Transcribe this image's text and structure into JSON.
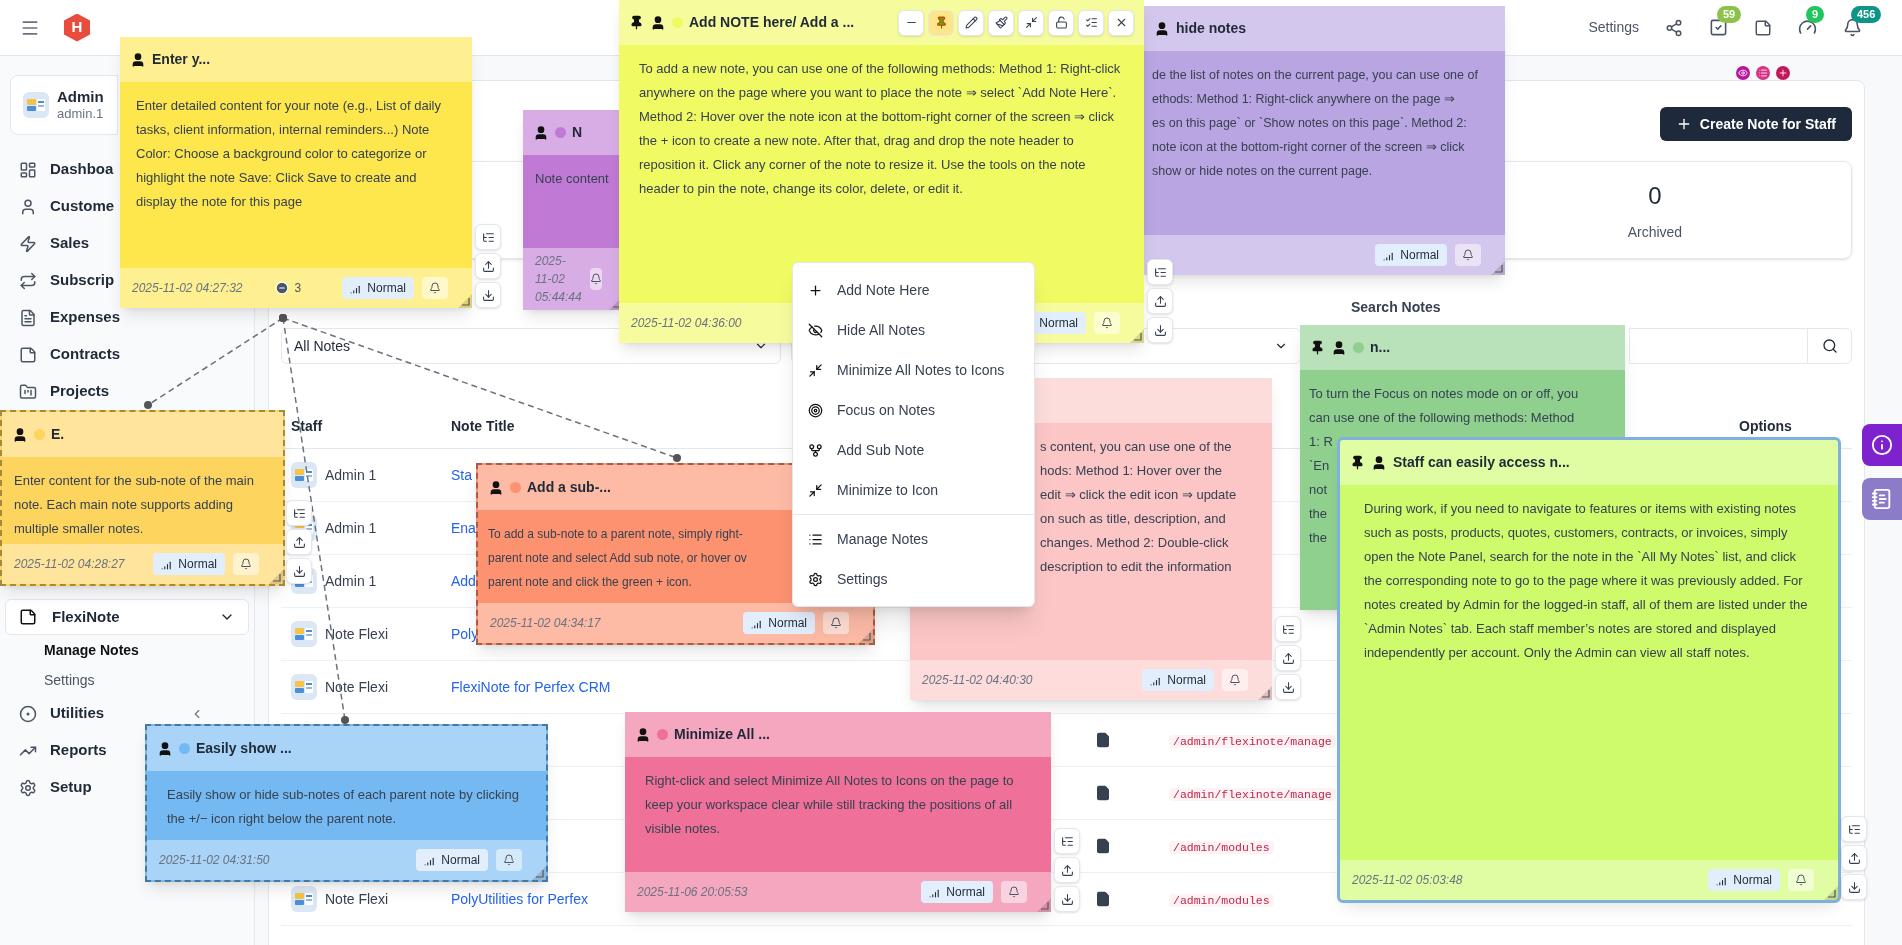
{
  "header": {
    "logo": "H",
    "settings_label": "Settings",
    "badges": [
      {
        "count": "59",
        "color": "#8bc34a"
      },
      {
        "count": "9",
        "color": "#22c55e"
      },
      {
        "count": "456",
        "color": "#0f9488"
      }
    ]
  },
  "sidebar": {
    "profile": {
      "name": "Admin",
      "email": "admin.1"
    },
    "items": [
      {
        "label": "Dashboa"
      },
      {
        "label": "Custome"
      },
      {
        "label": "Sales"
      },
      {
        "label": "Subscrip"
      },
      {
        "label": "Expenses"
      },
      {
        "label": "Contracts"
      },
      {
        "label": "Projects"
      }
    ],
    "group": {
      "label": "FlexiNote",
      "expanded": true,
      "children": [
        {
          "label": "Manage Notes",
          "selected": true
        },
        {
          "label": "Settings",
          "selected": false
        }
      ]
    },
    "items_after": [
      {
        "label": "Utilities"
      },
      {
        "label": "Reports"
      },
      {
        "label": "Setup"
      }
    ]
  },
  "main": {
    "create_button": "Create Note for Staff",
    "stats": [
      {
        "value": "0",
        "label": "Archived"
      }
    ],
    "staff_filter": {
      "value": "All Notes"
    },
    "search_label": "Search Notes",
    "table": {
      "columns": [
        "Staff",
        "Note Title",
        "Options"
      ],
      "rows": [
        {
          "staff": "Admin 1",
          "title": "Sta"
        },
        {
          "staff": "Admin 1",
          "title": "Ena"
        },
        {
          "staff": "Admin 1",
          "title": "Add"
        },
        {
          "staff": "Note Flexi",
          "title": "Poly"
        },
        {
          "staff": "Note Flexi",
          "title": "FlexiNote for Perfex CRM"
        },
        {
          "url": "/admin/flexinote/manage"
        },
        {
          "url": "/admin/flexinote/manage"
        },
        {
          "url": "/admin/modules"
        },
        {
          "staff": "Note Flexi",
          "title": "PolyUtilities for Perfex",
          "url": "/admin/modules"
        }
      ]
    }
  },
  "notes": [
    {
      "title": "Enter y...",
      "color": "#fde74c",
      "side_tools": true,
      "body": "Enter detailed content for your note (e.g., List of daily tasks, client information, internal reminders...) Note Color: Choose a background color to categorize or highlight the note Save: Click Save to create and display the note for this page",
      "timestamp": "2025-11-02 04:27:32",
      "count": "3",
      "priority": "Normal"
    },
    {
      "title": "N",
      "color": "#c07ad6",
      "dot": true,
      "body": "Note content",
      "timestamp": "2025-11-02 05:44:44"
    },
    {
      "title": "Add NOTE here/ Add a ...",
      "color": "#f0fa63",
      "pinned": true,
      "dot": true,
      "side_tools": true,
      "toolbar": {
        "pin_active": true
      },
      "body": "To add a new note, you can use one of the following methods: Method 1: Right-click anywhere on the page where you want to place the note ⇒ select `Add Note Here`. Method 2: Hover over the note icon at the bottom-right corner of the screen ⇒ click the + icon to create a new note. After that, drag and drop the note header to reposition it. Click any corner of the note to resize it. Use the tools on the note header to pin the note, change its color, delete, or edit it.",
      "timestamp": "2025-11-02 04:36:00",
      "priority": "Normal"
    },
    {
      "title": "hide notes",
      "color": "#b9a5e2",
      "body": "de the list of notes on the current page, you can use one of\nethods: Method 1: Right-click anywhere on the page ⇒\nes on this page` or `Show notes on this page`. Method 2:\nnote icon at the bottom-right corner of the screen ⇒ click\nshow or hide notes on the current page.",
      "priority": "Normal"
    },
    {
      "color": "#fcc6c6",
      "side_tools": true,
      "body": "s content, you can use one of the\nhods: Method 1: Hover over the\nedit ⇒ click the edit icon ⇒ update\non such as title, description, and\nchanges. Method 2: Double-click\ndescription to edit the information",
      "timestamp": "2025-11-02 04:40:30",
      "priority": "Normal"
    },
    {
      "title": "n...",
      "color": "#8fd08f",
      "pinned": true,
      "dot": true,
      "body": "To turn the Focus on notes mode on or off, you\ncan use one of the following methods: Method\n1: R\n`En\nnot\nthe\nthe"
    },
    {
      "title": "Staff can easily access n...",
      "color": "#cdfb6c",
      "pinned": true,
      "outlined": true,
      "side_tools": true,
      "body": "During work, if you need to navigate to features or items with existing notes such as posts, products, quotes, customers, contracts, or invoices, simply open the Note Panel, search for the note in the `All My Notes` list, and click the corresponding note to go to the page where it was previously added. For notes created by Admin for the logged-in staff, all of them are listed under the `Admin Notes` tab. Each staff member’s notes are stored and displayed independently per account. Only the Admin can view all staff notes.",
      "timestamp": "2025-11-02 05:03:48",
      "priority": "Normal"
    },
    {
      "title": "E.",
      "color": "#fdd55e",
      "dot": true,
      "dashed": true,
      "side_tools": true,
      "body": "Enter content for the sub-note of the main note. Each main note supports adding multiple smaller notes.",
      "timestamp": "2025-11-02 04:28:27",
      "priority": "Normal"
    },
    {
      "title": "Add a sub-...",
      "color": "#fc9270",
      "dot": true,
      "dashed": true,
      "body": "To add a sub-note to a parent note, simply right-\nparent note and select Add sub note, or hover ov\nparent note and click the green + icon.",
      "timestamp": "2025-11-02 04:34:17",
      "priority": "Normal"
    },
    {
      "title": "Easily show ...",
      "color": "#74b9f2",
      "dot": true,
      "dashed": true,
      "body": "Easily show or hide sub-notes of each parent note by clicking the +/− icon right below the parent note.",
      "timestamp": "2025-11-02 04:31:50",
      "priority": "Normal"
    },
    {
      "title": "Minimize All ...",
      "color": "#ef7199",
      "dot": true,
      "side_tools": true,
      "body": "Right-click and select Minimize All Notes to Icons on the page to keep your workspace clear while still tracking the positions of all visible notes.",
      "timestamp": "2025-11-06 20:05:53",
      "priority": "Normal"
    }
  ],
  "context_menu": {
    "groups": [
      [
        {
          "label": "Add Note Here"
        },
        {
          "label": "Hide All Notes"
        },
        {
          "label": "Minimize All Notes to Icons"
        },
        {
          "label": "Focus on Notes"
        },
        {
          "label": "Add Sub Note"
        },
        {
          "label": "Minimize to Icon"
        }
      ],
      [
        {
          "label": "Manage Notes"
        },
        {
          "label": "Settings"
        }
      ]
    ]
  }
}
